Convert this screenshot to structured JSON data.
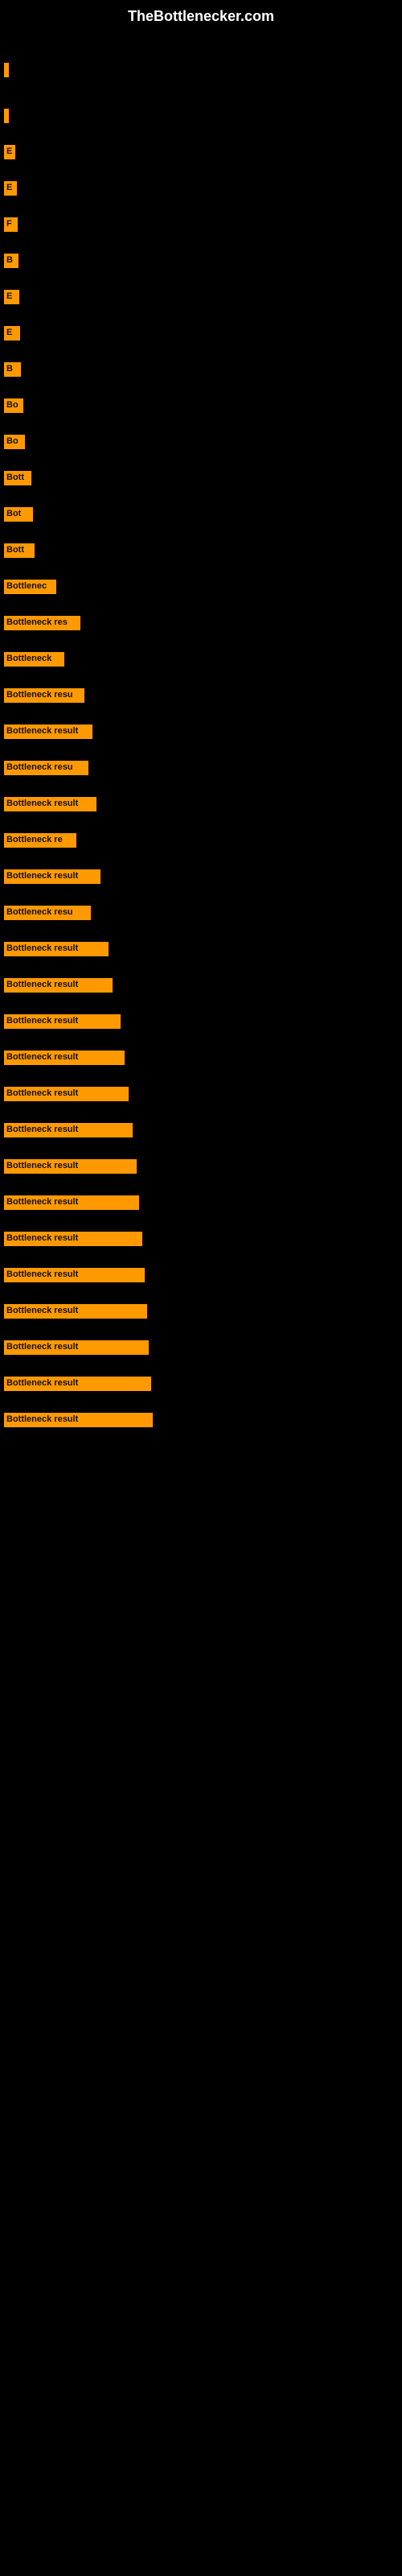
{
  "site": {
    "title": "TheBottlenecker.com"
  },
  "bars": [
    {
      "label": "",
      "width": 4,
      "marginTop": 30
    },
    {
      "label": "",
      "width": 4,
      "marginTop": 30
    },
    {
      "label": "E",
      "width": 14,
      "marginTop": 20
    },
    {
      "label": "E",
      "width": 16,
      "marginTop": 20
    },
    {
      "label": "F",
      "width": 17,
      "marginTop": 20
    },
    {
      "label": "B",
      "width": 18,
      "marginTop": 20
    },
    {
      "label": "E",
      "width": 19,
      "marginTop": 20
    },
    {
      "label": "E",
      "width": 20,
      "marginTop": 20
    },
    {
      "label": "B",
      "width": 21,
      "marginTop": 20
    },
    {
      "label": "Bo",
      "width": 24,
      "marginTop": 20
    },
    {
      "label": "Bo",
      "width": 26,
      "marginTop": 20
    },
    {
      "label": "Bott",
      "width": 34,
      "marginTop": 20
    },
    {
      "label": "Bot",
      "width": 36,
      "marginTop": 20
    },
    {
      "label": "Bott",
      "width": 38,
      "marginTop": 20
    },
    {
      "label": "Bottlenec",
      "width": 65,
      "marginTop": 20
    },
    {
      "label": "Bottleneck res",
      "width": 95,
      "marginTop": 20
    },
    {
      "label": "Bottleneck",
      "width": 75,
      "marginTop": 20
    },
    {
      "label": "Bottleneck resu",
      "width": 100,
      "marginTop": 20
    },
    {
      "label": "Bottleneck result",
      "width": 110,
      "marginTop": 20
    },
    {
      "label": "Bottleneck resu",
      "width": 105,
      "marginTop": 20
    },
    {
      "label": "Bottleneck result",
      "width": 115,
      "marginTop": 20
    },
    {
      "label": "Bottleneck re",
      "width": 90,
      "marginTop": 20
    },
    {
      "label": "Bottleneck result",
      "width": 120,
      "marginTop": 20
    },
    {
      "label": "Bottleneck resu",
      "width": 108,
      "marginTop": 20
    },
    {
      "label": "Bottleneck result",
      "width": 130,
      "marginTop": 20
    },
    {
      "label": "Bottleneck result",
      "width": 135,
      "marginTop": 20
    },
    {
      "label": "Bottleneck result",
      "width": 145,
      "marginTop": 20
    },
    {
      "label": "Bottleneck result",
      "width": 150,
      "marginTop": 20
    },
    {
      "label": "Bottleneck result",
      "width": 155,
      "marginTop": 20
    },
    {
      "label": "Bottleneck result",
      "width": 160,
      "marginTop": 20
    },
    {
      "label": "Bottleneck result",
      "width": 165,
      "marginTop": 20
    },
    {
      "label": "Bottleneck result",
      "width": 168,
      "marginTop": 20
    },
    {
      "label": "Bottleneck result",
      "width": 172,
      "marginTop": 20
    },
    {
      "label": "Bottleneck result",
      "width": 175,
      "marginTop": 20
    },
    {
      "label": "Bottleneck result",
      "width": 178,
      "marginTop": 20
    },
    {
      "label": "Bottleneck result",
      "width": 180,
      "marginTop": 20
    },
    {
      "label": "Bottleneck result",
      "width": 183,
      "marginTop": 20
    },
    {
      "label": "Bottleneck result",
      "width": 185,
      "marginTop": 20
    }
  ]
}
